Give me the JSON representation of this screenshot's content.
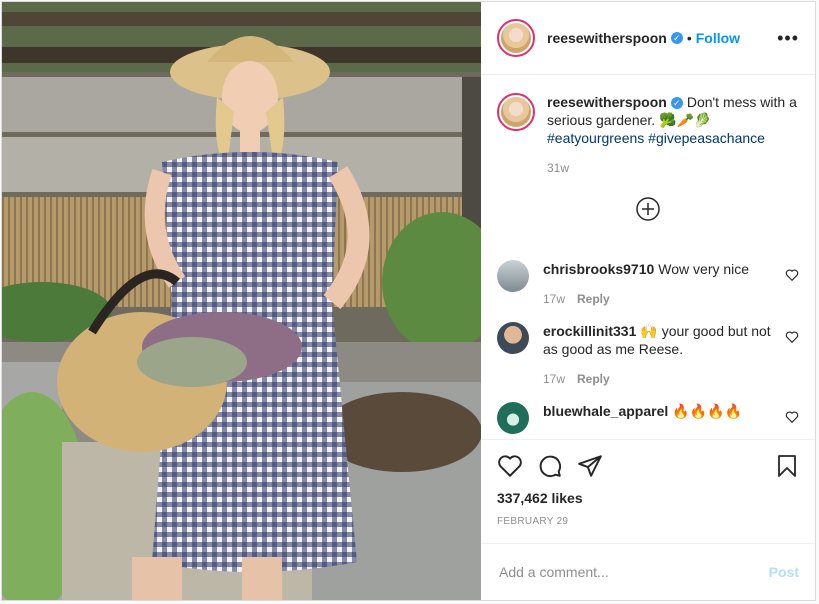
{
  "header": {
    "username": "reesewitherspoon",
    "verified_icon": "verified-badge-icon",
    "separator": "•",
    "follow_label": "Follow",
    "more_label": "•••"
  },
  "caption": {
    "username": "reesewitherspoon",
    "text": "Don't mess with a serious gardener. 🥦🥕🥬",
    "hashtags": "#eatyourgreens #givepeasachance",
    "age": "31w"
  },
  "comments": [
    {
      "username": "chrisbrooks9710",
      "text": "Wow very nice",
      "age": "17w",
      "reply_label": "Reply"
    },
    {
      "username": "erockillinit331",
      "text": "🙌 your good but not as good as me Reese.",
      "age": "17w",
      "reply_label": "Reply"
    },
    {
      "username": "bluewhale_apparel",
      "text": "🔥🔥🔥🔥",
      "age": "",
      "reply_label": ""
    }
  ],
  "likes": "337,462 likes",
  "date": "FEBRUARY 29",
  "add_comment": {
    "placeholder": "Add a comment...",
    "post_label": "Post"
  },
  "colors": {
    "accent": "#0095f6",
    "verified": "#3897f0",
    "post_disabled": "#b2dffc",
    "gingham": "#2b3566"
  }
}
